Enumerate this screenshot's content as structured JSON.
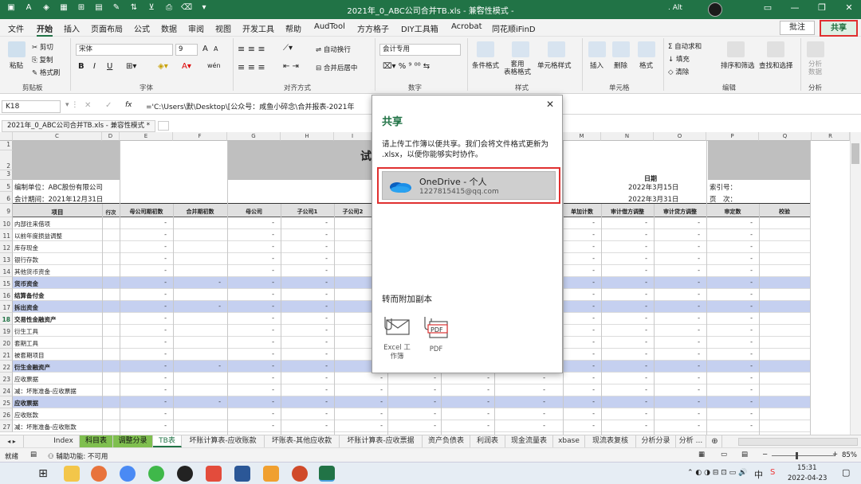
{
  "title_bar": {
    "title": "2021年_0_ABC公司合并TB.xls - 兼容性模式 -",
    "user": ". Alt",
    "quick_access": [
      "save-icon",
      "undo-icon",
      "redo-icon",
      "font-color-icon",
      "fill-color-icon",
      "border-icon",
      "grid-icon",
      "chart-icon",
      "brush-icon",
      "sort-icon",
      "filter-icon",
      "print-icon",
      "clear-icon",
      "more-icon"
    ],
    "window_buttons": [
      "—",
      "❐",
      "✕"
    ]
  },
  "menu": {
    "tabs": [
      "文件",
      "开始",
      "插入",
      "页面布局",
      "公式",
      "数据",
      "审阅",
      "视图",
      "开发工具",
      "帮助",
      "AudTool",
      "方方格子",
      "DIY工具箱",
      "Acrobat",
      "同花顺iFinD"
    ],
    "active": "开始",
    "comment": "批注",
    "share": "共享"
  },
  "ribbon": {
    "clipboard": {
      "paste": "粘贴",
      "cut": "剪切",
      "copy": "复制",
      "format_painter": "格式刷",
      "group": "剪贴板"
    },
    "font": {
      "name": "宋体",
      "size": "9",
      "bold": "B",
      "italic": "I",
      "underline": "U",
      "grow": "A",
      "shrink": "A",
      "wen": "wén",
      "group": "字体"
    },
    "alignment": {
      "wrap": "自动换行",
      "merge": "合并后居中",
      "group": "对齐方式"
    },
    "number": {
      "format": "会计专用",
      "group": "数字"
    },
    "styles": {
      "conditional": "条件格式",
      "table": "套用\n表格格式",
      "cell_styles": "单元格样式",
      "group": "样式"
    },
    "cells": {
      "insert": "插入",
      "delete": "删除",
      "format": "格式",
      "group": "单元格"
    },
    "editing": {
      "autosum": "自动求和",
      "fill": "填充",
      "clear": "清除",
      "sort": "排序和筛选",
      "find": "查找和选择",
      "group": "编辑"
    },
    "analysis": {
      "analyze": "分析\n数据",
      "group": "分析"
    }
  },
  "formula_bar": {
    "name_box": "K18",
    "fx": "fx",
    "formula": "='C:\\Users\\默\\Desktop\\[公众号：咸鱼小碎念\\合并报表-2021年"
  },
  "workbook_tab": "2021年_0_ABC公司合并TB.xls - 兼容性模式 *",
  "grid": {
    "columns": [
      "C",
      "D",
      "E",
      "F",
      "G",
      "H",
      "I",
      "",
      "",
      "N",
      "O",
      "P",
      "Q"
    ],
    "headers": [
      "项目",
      "行次",
      "母公司期初数",
      "合并期初数",
      "母公司",
      "子公司1",
      "子公司2",
      "",
      "单加计数",
      "审计借方调整",
      "审计贷方调整",
      "审定数",
      "校验"
    ],
    "title_partial": "试",
    "date_label": "日期",
    "company": "编制单位：ABC股份有限公司",
    "period": "会计期间：2021年12月31日",
    "date1": "2022年3月15日",
    "date2": "2022年3月31日",
    "index_no": "索引号：",
    "page": "页　次：",
    "rows": [
      {
        "n": "10",
        "label": "内部往来借项",
        "sub": false
      },
      {
        "n": "11",
        "label": "以前年度损益调整",
        "sub": false
      },
      {
        "n": "12",
        "label": "库存现金",
        "sub": false
      },
      {
        "n": "13",
        "label": "银行存款",
        "sub": false
      },
      {
        "n": "14",
        "label": "其他货币资金",
        "sub": false
      },
      {
        "n": "15",
        "label": "货币资金",
        "sub": true
      },
      {
        "n": "16",
        "label": "结算备付金",
        "sub": false,
        "bold": true
      },
      {
        "n": "17",
        "label": "拆出资金",
        "sub": true
      },
      {
        "n": "18",
        "label": "交易性金融资产",
        "sub": false,
        "bold": true
      },
      {
        "n": "19",
        "label": "衍生工具",
        "sub": false
      },
      {
        "n": "20",
        "label": "套期工具",
        "sub": false
      },
      {
        "n": "21",
        "label": "被套期项目",
        "sub": false
      },
      {
        "n": "22",
        "label": "衍生金融资产",
        "sub": true
      },
      {
        "n": "23",
        "label": "应收票据",
        "sub": false
      },
      {
        "n": "24",
        "label": "减：坏账准备-应收票据",
        "sub": false
      },
      {
        "n": "25",
        "label": "应收票据",
        "sub": true
      },
      {
        "n": "26",
        "label": "应收账款",
        "sub": false
      },
      {
        "n": "27",
        "label": "减：坏账准备-应收账款",
        "sub": false
      }
    ],
    "header_rows": [
      "1",
      "2",
      "3",
      "5",
      "6",
      "9"
    ],
    "dash": "-"
  },
  "sheet_tabs": [
    "Index",
    "科目表",
    "调整分录",
    "TB表",
    "坏账计算表-应收账款",
    "坏账表-其他应收款",
    "坏账计算表-应收票据",
    "资产负债表",
    "利润表",
    "现金流量表",
    "xbase",
    "现流表复核",
    "分析分录",
    "分析 ..."
  ],
  "status": {
    "ready": "就绪",
    "accessibility": "辅助功能: 不可用",
    "zoom": "85%"
  },
  "taskbar": {
    "time": "15:31",
    "date": "2022-04-23",
    "ime": "中",
    "apps": [
      "start-icon",
      "search-icon",
      "task-view-icon",
      "file-explorer-icon",
      "firefox-icon",
      "chrome-icon",
      "wechat-icon",
      "qq-icon",
      "app-icon",
      "word-icon",
      "search-app-icon",
      "powerpoint-icon",
      "excel-icon"
    ]
  },
  "dialog": {
    "title": "共享",
    "close": "✕",
    "description": "请上传工作簿以便共享。我们会将文件格式更新为 .xlsx，以便你能够实时协作。",
    "onedrive_name": "OneDrive - 个人",
    "onedrive_email": "1227815415@qq.com",
    "attach_title": "转而附加副本",
    "attach_excel": "Excel 工作簿",
    "attach_pdf": "PDF",
    "pdf_badge": "PDF"
  }
}
